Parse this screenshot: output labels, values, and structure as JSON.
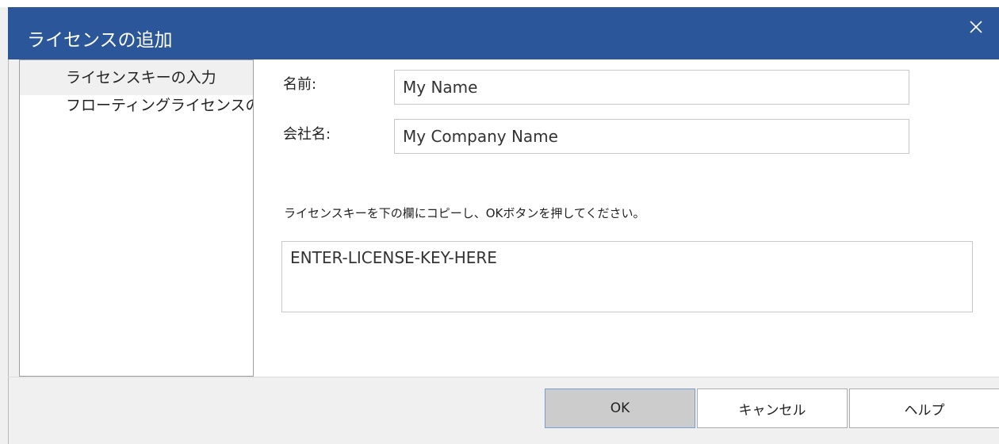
{
  "window": {
    "title": "ライセンスの追加",
    "close_icon": "close-icon"
  },
  "nav": {
    "items": [
      {
        "label": "ライセンスキーの入力",
        "selected": true
      },
      {
        "label": "フローティングライセンスの取"
      }
    ]
  },
  "form": {
    "name_label": "名前:",
    "name_value": "My Name",
    "company_label": "会社名:",
    "company_value": "My Company Name",
    "instruction": "ライセンスキーを下の欄にコピーし、OKボタンを押してください。",
    "license_key_value": "ENTER-LICENSE-KEY-HERE"
  },
  "buttons": {
    "ok": "OK",
    "cancel": "キャンセル",
    "help": "ヘルプ"
  },
  "colors": {
    "titlebar": "#2b579a",
    "window_bg": "#f0f0f0"
  }
}
